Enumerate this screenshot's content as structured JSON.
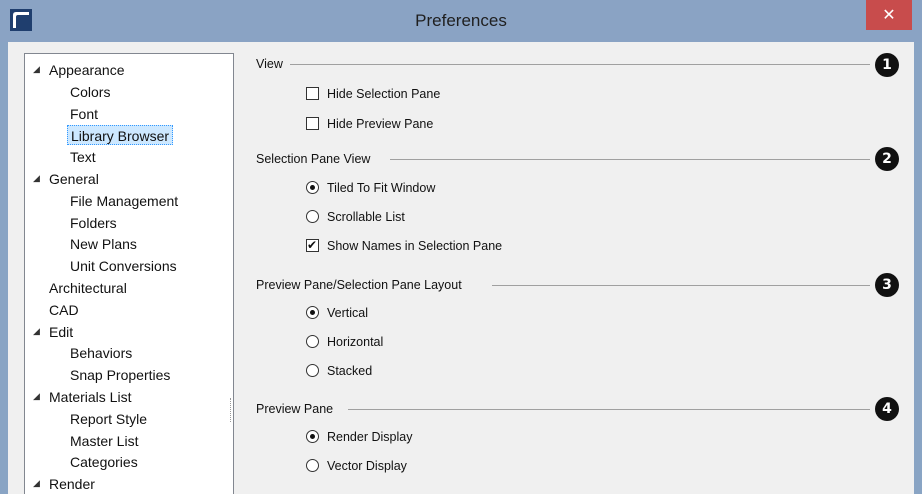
{
  "window": {
    "title": "Preferences",
    "close_glyph": "✕",
    "app_icon": "app-logo-icon"
  },
  "tree": {
    "items": [
      {
        "label": "Appearance",
        "level": 0,
        "expanded": true
      },
      {
        "label": "Colors",
        "level": 1
      },
      {
        "label": "Font",
        "level": 1
      },
      {
        "label": "Library Browser",
        "level": 1,
        "selected": true
      },
      {
        "label": "Text",
        "level": 1
      },
      {
        "label": "General",
        "level": 0,
        "expanded": true
      },
      {
        "label": "File Management",
        "level": 1
      },
      {
        "label": "Folders",
        "level": 1
      },
      {
        "label": "New Plans",
        "level": 1
      },
      {
        "label": "Unit Conversions",
        "level": 1
      },
      {
        "label": "Architectural",
        "level": 0
      },
      {
        "label": "CAD",
        "level": 0
      },
      {
        "label": "Edit",
        "level": 0,
        "expanded": true
      },
      {
        "label": "Behaviors",
        "level": 1
      },
      {
        "label": "Snap Properties",
        "level": 1
      },
      {
        "label": "Materials List",
        "level": 0,
        "expanded": true
      },
      {
        "label": "Report Style",
        "level": 1
      },
      {
        "label": "Master List",
        "level": 1
      },
      {
        "label": "Categories",
        "level": 1
      },
      {
        "label": "Render",
        "level": 0,
        "expanded": true
      }
    ],
    "expander_glyph": "◢"
  },
  "view": {
    "label": "View",
    "badge": "1",
    "hide_selection_pane": {
      "label": "Hide Selection Pane",
      "checked": false
    },
    "hide_preview_pane": {
      "label": "Hide Preview Pane",
      "checked": false
    }
  },
  "selection_view": {
    "label": "Selection Pane View",
    "badge": "2",
    "tiled": {
      "label": "Tiled To Fit Window",
      "selected": true
    },
    "scrollable": {
      "label": "Scrollable List",
      "selected": false
    },
    "show_names": {
      "label": "Show Names in Selection Pane",
      "checked": true
    }
  },
  "layout": {
    "label": "Preview Pane/Selection Pane Layout",
    "badge": "3",
    "vertical": {
      "label": "Vertical",
      "selected": true
    },
    "horizontal": {
      "label": "Horizontal",
      "selected": false
    },
    "stacked": {
      "label": "Stacked",
      "selected": false
    }
  },
  "preview": {
    "label": "Preview Pane",
    "badge": "4",
    "render": {
      "label": "Render Display",
      "selected": true
    },
    "vector": {
      "label": "Vector Display",
      "selected": false
    }
  },
  "colors": {
    "titlebar": "#8aa3c4",
    "close": "#c84c4c",
    "selection": "#cde8ff"
  }
}
